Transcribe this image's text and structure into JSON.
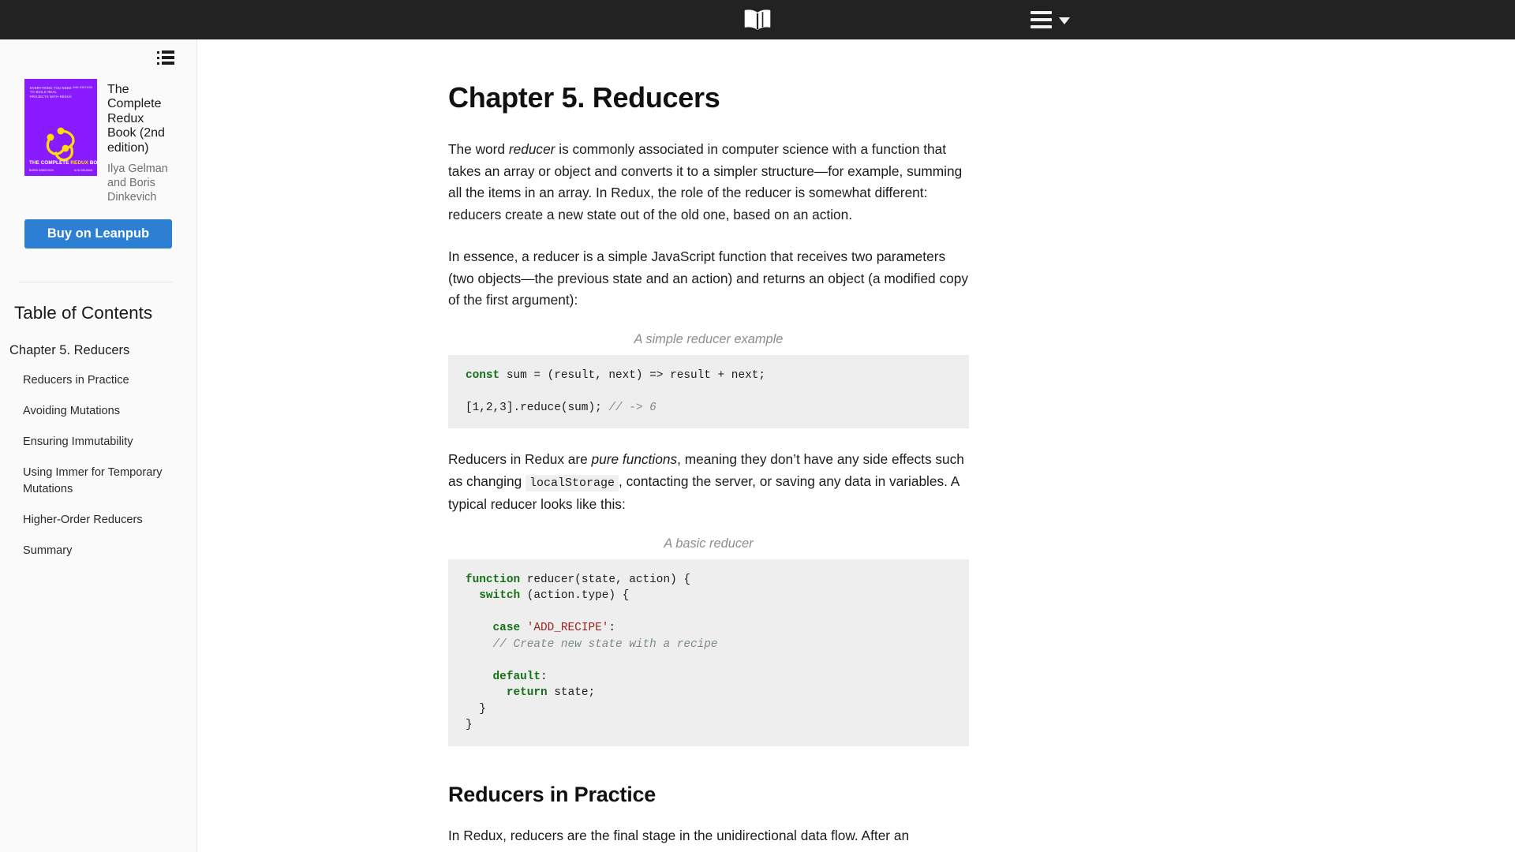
{
  "topbar": {
    "logo_icon": "open-book-icon",
    "menu_icon": "hamburger-menu-icon",
    "caret_icon": "chevron-down-icon"
  },
  "sidebar": {
    "toggle_icon": "list-view-icon",
    "book": {
      "cover": {
        "tagline": "Everything you need to build real projects with Redux",
        "edition_badge": "2nd edition",
        "spine_title_prefix": "THE COMPLETE ",
        "spine_title_highlight": "REDUX",
        "spine_title_suffix": " BOOK",
        "credit_left": "BORIS DINKEVICH",
        "credit_right": "ILYA GELMAN",
        "background_color": "#8a1aff",
        "highlight_color": "#ffe000"
      },
      "title": "The Complete Redux Book (2nd edition)",
      "authors": "Ilya Gelman and Boris Dinkevich"
    },
    "buy_button": {
      "label": "Buy on Leanpub",
      "color": "#2d7fd3"
    },
    "toc_heading": "Table of Contents",
    "toc": {
      "chapter": "Chapter 5. Reducers",
      "sections": [
        "Reducers in Practice",
        "Avoiding Mutations",
        "Ensuring Immutability",
        "Using Immer for Temporary Mutations",
        "Higher-Order Reducers",
        "Summary"
      ]
    }
  },
  "article": {
    "chapter_title": "Chapter 5. Reducers",
    "paragraph_1": {
      "part1": "The word ",
      "italic1": "reducer",
      "part2": " is commonly associated in computer science with a function that takes an array or object and converts it to a simpler structure—for example, summing all the items in an array. In Redux, the role of the reducer is somewhat different: reducers create a new state out of the old one, based on an action."
    },
    "paragraph_2": "In essence, a reducer is a simple JavaScript function that receives two parameters (two objects—the previous state and an action) and returns an object (a modified copy of the first argument):",
    "code_1": {
      "caption": "A simple reducer example",
      "line1_kw": "const",
      "line1_rest": " sum = (result, next) => result + next;",
      "line3_code": "[1,2,3].reduce(sum); ",
      "line3_comment": "// -> 6"
    },
    "paragraph_3": {
      "part1": "Reducers in Redux are ",
      "italic1": "pure functions",
      "part2": ", meaning they don’t have any side effects such as changing ",
      "code1": "localStorage",
      "part3": ", contacting the server, or saving any data in variables. A typical reducer looks like this:"
    },
    "code_2": {
      "caption": "A basic reducer",
      "l1_kw": "function",
      "l1_rest": " reducer(state, action) {",
      "l2_kw": "switch",
      "l2_rest": " (action.type) {",
      "l3_kw": "case",
      "l3_str": "'ADD_RECIPE'",
      "l3_rest": ":",
      "l4_com": "// Create new state with a recipe",
      "l5_kw": "default",
      "l5_rest": ":",
      "l6_kw": "return",
      "l6_rest": " state;",
      "l7": "  }",
      "l8": "}"
    },
    "section_title": "Reducers in Practice",
    "paragraph_4": "In Redux, reducers are the final stage in the unidirectional data flow. After an"
  }
}
